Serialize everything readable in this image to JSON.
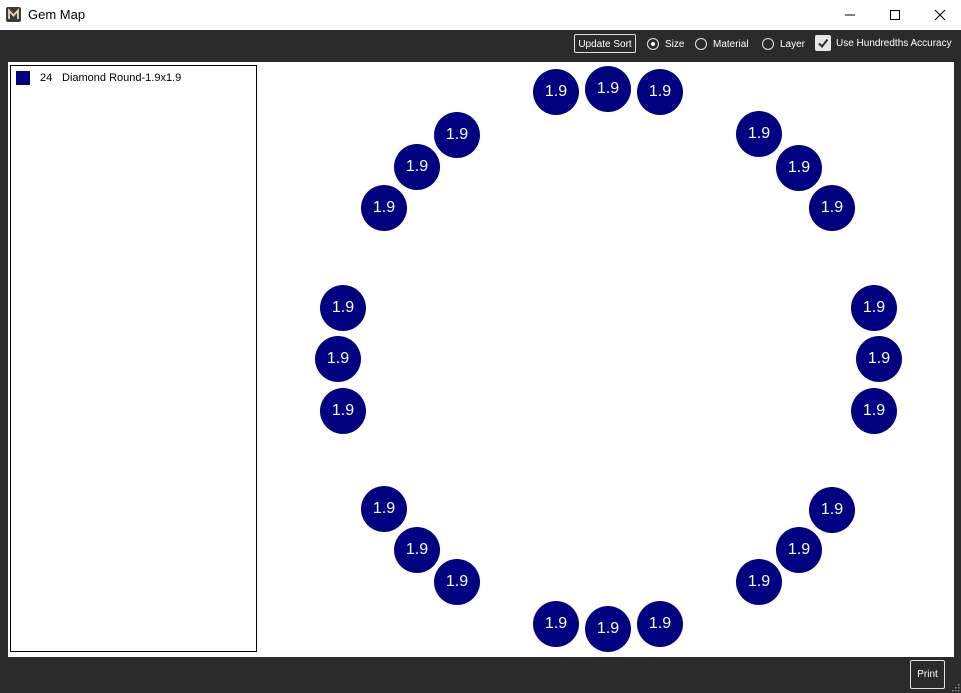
{
  "window": {
    "title": "Gem Map",
    "app_icon": "m-logo-icon",
    "controls": [
      "minimize-icon",
      "maximize-icon",
      "close-icon"
    ]
  },
  "toolbar": {
    "update_sort_label": "Update Sort",
    "sort_options": [
      {
        "label": "Size",
        "checked": true
      },
      {
        "label": "Material",
        "checked": false
      },
      {
        "label": "Layer",
        "checked": false
      }
    ],
    "hundredths_label": "Use Hundredths Accuracy",
    "hundredths_checked": true
  },
  "legend": {
    "items": [
      {
        "count": "24",
        "label": "Diamond Round-1.9x1.9",
        "color": "#000080"
      }
    ]
  },
  "gem_map": {
    "gem_color": "#000080",
    "gem_text_color": "#ffffff",
    "gem_labels": [
      "1.9",
      "1.9",
      "1.9",
      "1.9",
      "1.9",
      "1.9",
      "1.9",
      "1.9",
      "1.9",
      "1.9",
      "1.9",
      "1.9",
      "1.9",
      "1.9",
      "1.9",
      "1.9",
      "1.9",
      "1.9",
      "1.9",
      "1.9",
      "1.9",
      "1.9",
      "1.9",
      "1.9"
    ]
  },
  "footer": {
    "print_label": "Print"
  }
}
